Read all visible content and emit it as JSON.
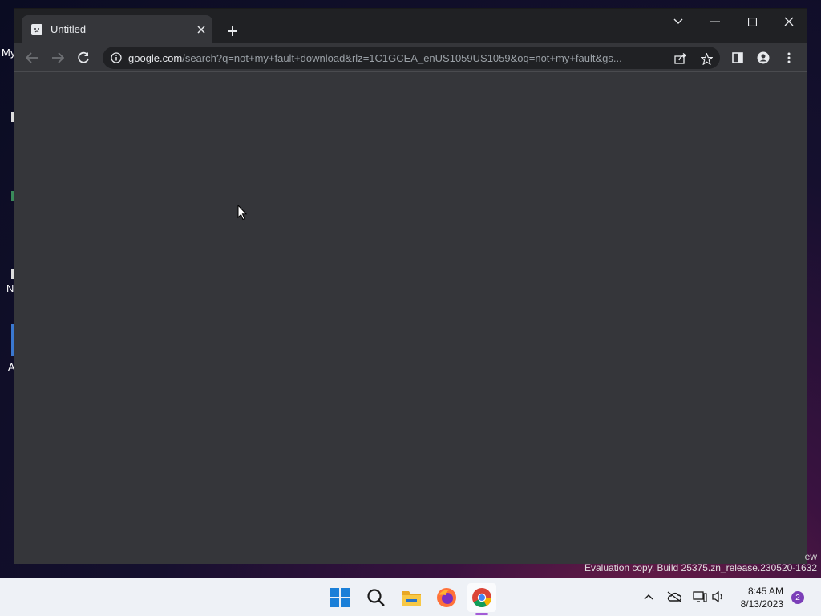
{
  "desktop": {
    "fragments": [
      "My",
      "N",
      "A"
    ]
  },
  "browser": {
    "tab": {
      "title": "Untitled"
    },
    "omnibox": {
      "host": "google.com",
      "path": "/search?q=not+my+fault+download&rlz=1C1GCEA_enUS1059US1059&oq=not+my+fault&gs..."
    }
  },
  "watermark": {
    "partial": "ew",
    "text": "Evaluation copy. Build 25375.zn_release.230520-1632"
  },
  "taskbar": {
    "apps": [
      "start-icon",
      "search-icon",
      "file-explorer-icon",
      "firefox-icon",
      "chrome-icon"
    ],
    "clock": {
      "time": "8:45 AM",
      "date": "8/13/2023"
    },
    "notification_count": "2"
  },
  "colors": {
    "window_bg": "#35363a",
    "titlebar_bg": "#202124",
    "taskbar_bg": "#eef1f6",
    "accent": "#a35bd6"
  }
}
